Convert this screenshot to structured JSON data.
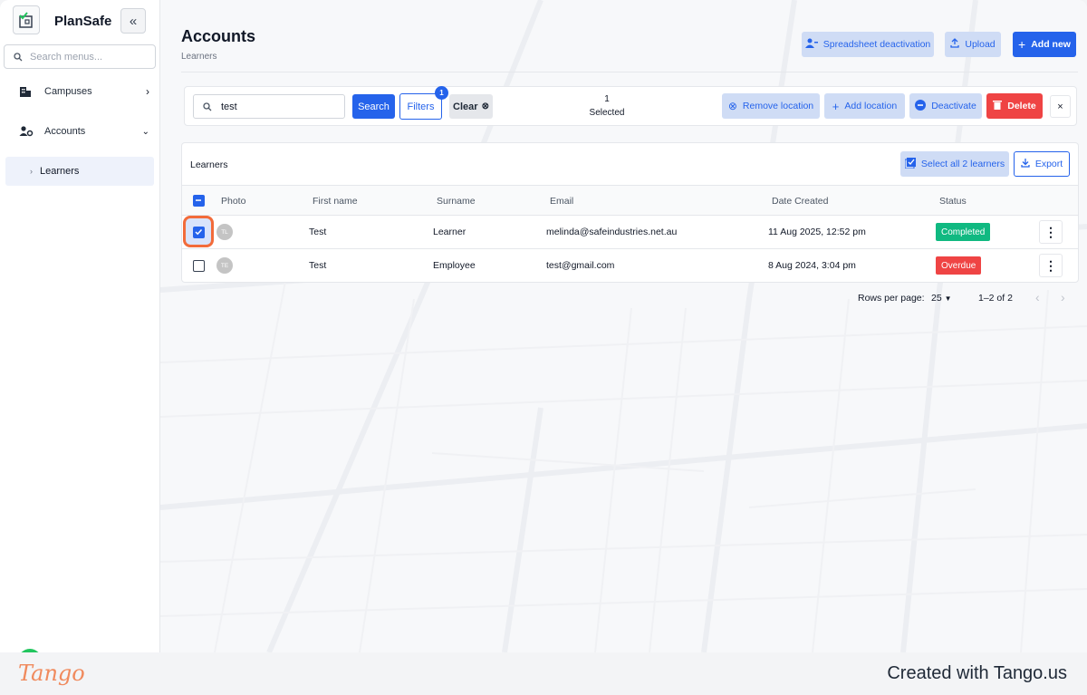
{
  "app": {
    "name": "PlanSafe"
  },
  "sidebar": {
    "search_placeholder": "Search menus...",
    "items": [
      {
        "label": "Campuses"
      },
      {
        "label": "Accounts"
      }
    ],
    "sub_items": [
      {
        "label": "Learners"
      }
    ]
  },
  "page": {
    "title": "Accounts",
    "breadcrumb": "Learners"
  },
  "header_actions": {
    "spreadsheet_label": "Spreadsheet deactivation",
    "upload_label": "Upload",
    "add_new_label": "Add new"
  },
  "toolbar": {
    "search_value": "test",
    "search_label": "Search",
    "filters_label": "Filters",
    "filters_count": "1",
    "clear_label": "Clear",
    "selected_count": "1",
    "selected_label": "Selected",
    "remove_location_label": "Remove location",
    "add_location_label": "Add location",
    "deactivate_label": "Deactivate",
    "delete_label": "Delete",
    "close_label": "×"
  },
  "table": {
    "title": "Learners",
    "select_all_label": "Select all 2 learners",
    "export_label": "Export",
    "columns": [
      "Photo",
      "First name",
      "Surname",
      "Email",
      "Date Created",
      "Status"
    ],
    "rows": [
      {
        "initials": "TL",
        "first_name": "Test",
        "surname": "Learner",
        "email": "melinda@safeindustries.net.au",
        "date_created": "11 Aug 2025, 12:52 pm",
        "status": "Completed",
        "status_color": "#10b981",
        "checked": true
      },
      {
        "initials": "TE",
        "first_name": "Test",
        "surname": "Employee",
        "email": "test@gmail.com",
        "date_created": "8 Aug 2024, 3:04 pm",
        "status": "Overdue",
        "status_color": "#ef4444",
        "checked": false
      }
    ]
  },
  "pagination": {
    "rows_per_page_label": "Rows per page:",
    "rows_per_page_value": "25",
    "range": "1–2 of 2"
  },
  "footer": {
    "logo_text": "Tango",
    "created_text": "Created with Tango.us"
  },
  "colors": {
    "primary": "#2563eb",
    "danger": "#ef4444",
    "success": "#10b981",
    "highlight": "#f26b3a"
  }
}
